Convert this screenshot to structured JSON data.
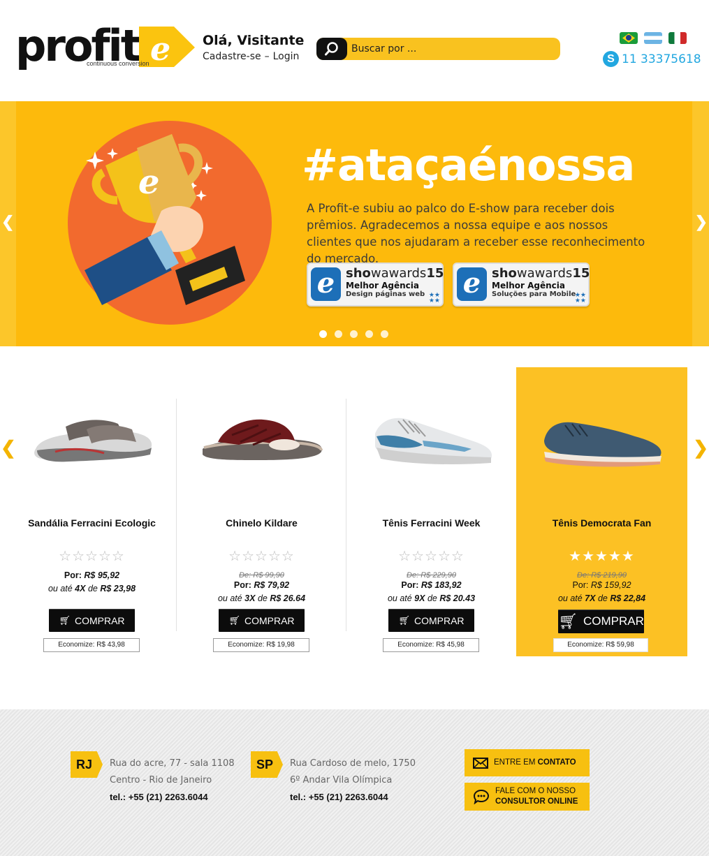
{
  "header": {
    "logo": {
      "word": "profit",
      "tagline": "continuous conversion"
    },
    "greeting": {
      "title": "Olá, Visitante",
      "signup": "Cadastre-se",
      "separator": "–",
      "login": "Login"
    },
    "search": {
      "placeholder": "Buscar por ..."
    },
    "flags": [
      "brazil-flag",
      "argentina-flag",
      "mexico-flag"
    ],
    "phone": "11 33375618"
  },
  "hero": {
    "title": "#ataçaénossa",
    "text": "A Profit-e subiu ao palco do E-show para receber dois prêmios. Agradecemos a nossa equipe e aos nossos clientes que nos ajudaram a receber esse reconhecimento do mercado.",
    "awards": [
      {
        "brand_a": "sho",
        "brand_b": "w",
        "brand_c": "awards",
        "year": "15",
        "line1": "Melhor Agência",
        "line2": "Design páginas web"
      },
      {
        "brand_a": "sho",
        "brand_b": "w",
        "brand_c": "awards",
        "year": "15",
        "line1": "Melhor Agência",
        "line2": "Soluções para Mobile"
      }
    ],
    "slide_count": 5,
    "active_slide": 1
  },
  "products": [
    {
      "name": "Sandália Ferracini Ecologic",
      "rating": 0,
      "old_price": "",
      "price_label": "Por: ",
      "price": "R$ 95,92",
      "install_a": "ou até ",
      "install_n": "4X",
      "install_b": " de ",
      "install_v": "R$ 23,98",
      "buy": "COMPRAR",
      "saving": "Economize: R$ 43,98"
    },
    {
      "name": "Chinelo Kildare",
      "rating": 0,
      "old_price": "De: R$ 99,90",
      "price_label": "Por: ",
      "price": "R$ 79,92",
      "install_a": "ou até ",
      "install_n": "3X",
      "install_b": " de ",
      "install_v": "R$ 26.64",
      "buy": "COMPRAR",
      "saving": "Economize: R$ 19,98"
    },
    {
      "name": "Tênis Ferracini Week",
      "rating": 0,
      "old_price": "De: R$ 229,90",
      "price_label": "Por: ",
      "price": "R$ 183,92",
      "install_a": "ou até ",
      "install_n": "9X",
      "install_b": " de ",
      "install_v": "R$ 20.43",
      "buy": "COMPRAR",
      "saving": "Economize: R$ 45,98"
    },
    {
      "name": "Tênis Democrata Fan",
      "rating": 5,
      "old_price": "De: R$ 219,90",
      "price_label": "Por: ",
      "price": "R$ 159,92",
      "install_a": "ou até ",
      "install_n": "7X",
      "install_b": " de ",
      "install_v": "R$ 22,84",
      "buy": "COMPRAR",
      "saving": "Economize: R$ 59,98"
    }
  ],
  "footer": {
    "offices": [
      {
        "state": "RJ",
        "line1": "Rua do acre, 77 - sala 1108",
        "line2": "Centro - Rio de Janeiro",
        "tel": "tel.: +55 (21) 2263.6044"
      },
      {
        "state": "SP",
        "line1": "Rua Cardoso de melo, 1750",
        "line2": "6º Andar Vila Olímpica",
        "tel": "tel.: +55 (21) 2263.6044"
      }
    ],
    "contact": {
      "a": "ENTRE EM ",
      "b": "CONTATO"
    },
    "chat": {
      "a": "FALE COM O NOSSO",
      "b": "CONSULTOR ONLINE"
    }
  },
  "colors": {
    "brand_yellow": "#fdba0c",
    "accent_yellow": "#f7c010",
    "skype_blue": "#22a7e0",
    "award_blue": "#1d6fb8",
    "hero_circle": "#f26a2e"
  }
}
